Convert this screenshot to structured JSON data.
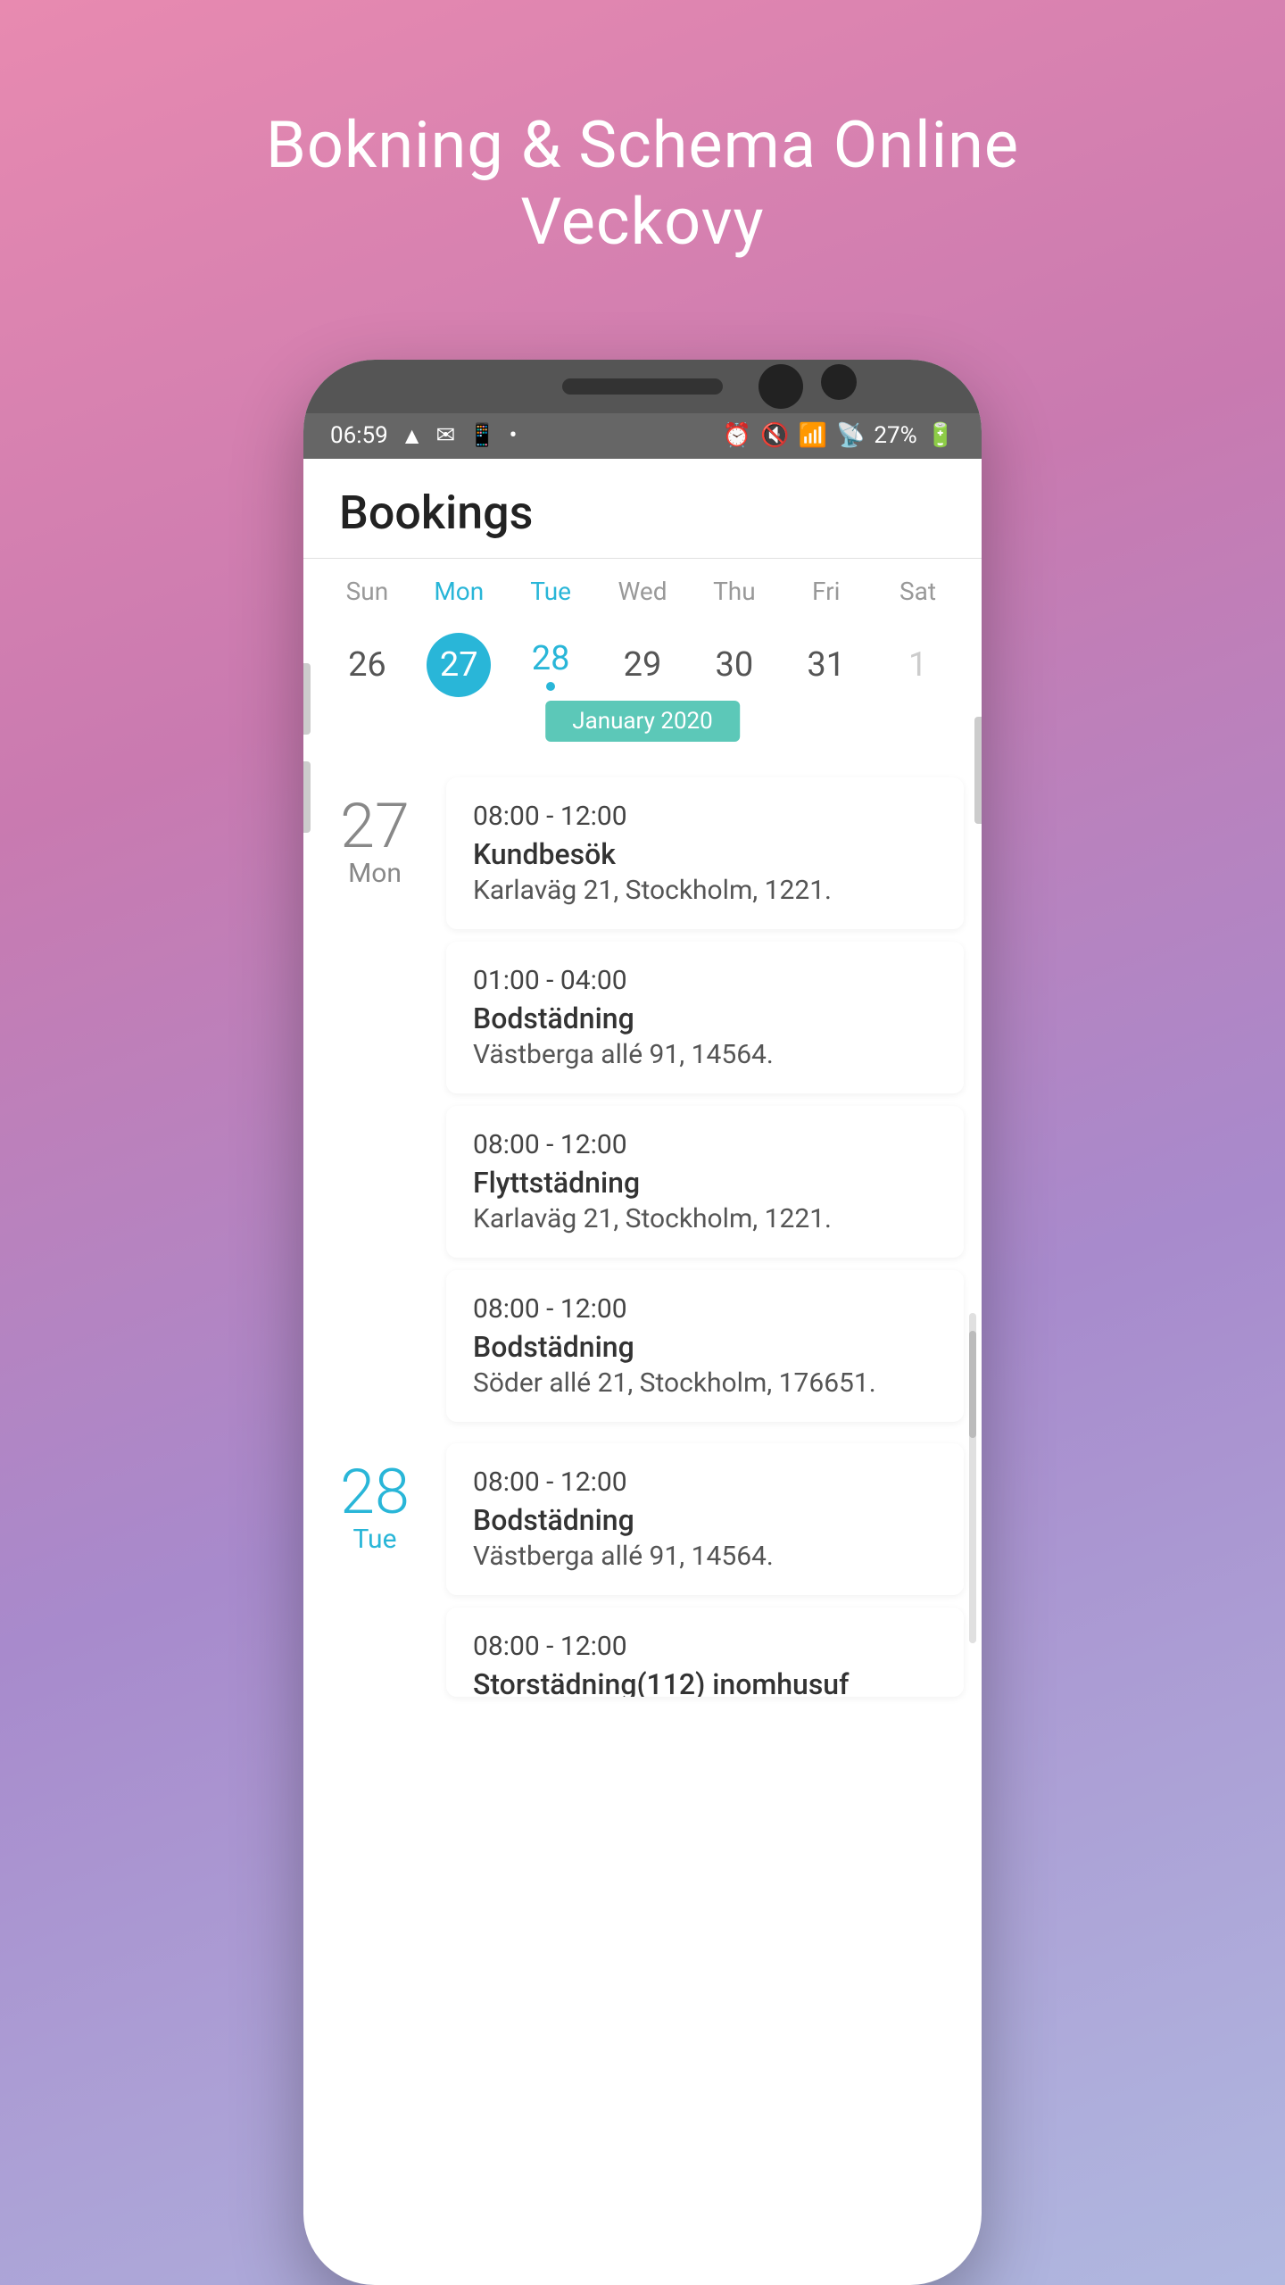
{
  "app": {
    "title_line1": "Bokning & Schema Online",
    "title_line2": "Veckovy"
  },
  "status_bar": {
    "time": "06:59",
    "battery": "27%"
  },
  "header": {
    "title": "Bookings"
  },
  "calendar": {
    "month_label": "January 2020",
    "weekdays": [
      {
        "label": "Sun",
        "highlight": false
      },
      {
        "label": "Mon",
        "highlight": true
      },
      {
        "label": "Tue",
        "highlight": true
      },
      {
        "label": "Wed",
        "highlight": false
      },
      {
        "label": "Thu",
        "highlight": false
      },
      {
        "label": "Fri",
        "highlight": false
      },
      {
        "label": "Sat",
        "highlight": false
      }
    ],
    "dates": [
      {
        "number": "26",
        "selected": false,
        "has_dot": false,
        "style": "normal"
      },
      {
        "number": "27",
        "selected": true,
        "has_dot": false,
        "style": "normal"
      },
      {
        "number": "28",
        "selected": false,
        "has_dot": true,
        "style": "blue"
      },
      {
        "number": "29",
        "selected": false,
        "has_dot": false,
        "style": "normal"
      },
      {
        "number": "30",
        "selected": false,
        "has_dot": false,
        "style": "normal"
      },
      {
        "number": "31",
        "selected": false,
        "has_dot": false,
        "style": "normal"
      },
      {
        "number": "1",
        "selected": false,
        "has_dot": false,
        "style": "light"
      }
    ]
  },
  "bookings": [
    {
      "day_number": "27",
      "day_name": "Mon",
      "day_style": "normal",
      "is_first_of_day": true,
      "cards": [
        {
          "time": "08:00 - 12:00",
          "type": "Kundbesök",
          "address": "Karlaväg 21, Stockholm, 1221."
        },
        {
          "time": "01:00 - 04:00",
          "type": "Bodstädning",
          "address": "Västberga allé 91, 14564."
        },
        {
          "time": "08:00 - 12:00",
          "type": "Flyttstädning",
          "address": "Karlaväg 21, Stockholm, 1221."
        },
        {
          "time": "08:00 - 12:00",
          "type": "Bodstädning",
          "address": "Söder allé 21, Stockholm, 176651."
        }
      ]
    },
    {
      "day_number": "28",
      "day_name": "Tue",
      "day_style": "blue",
      "is_first_of_day": true,
      "cards": [
        {
          "time": "08:00 - 12:00",
          "type": "Bodstädning",
          "address": "Västberga allé 91, 14564."
        },
        {
          "time": "08:00 - 12:00",
          "type": "Storstädning(112) inomhusuf",
          "address": ""
        }
      ]
    }
  ]
}
